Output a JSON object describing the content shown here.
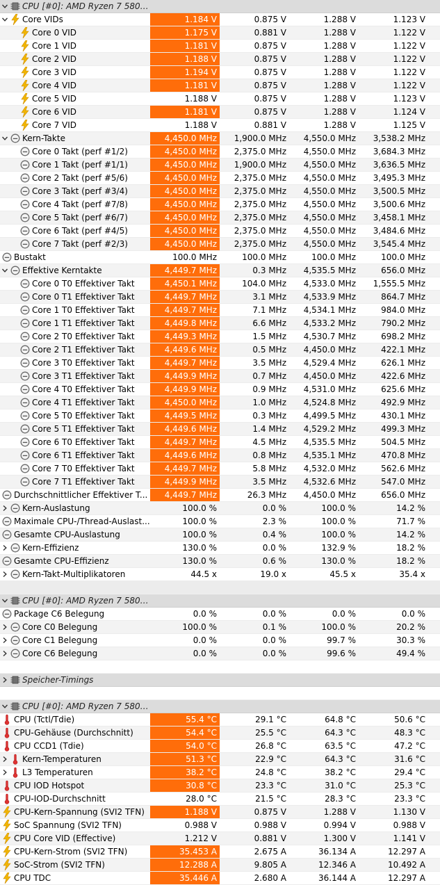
{
  "colors": {
    "highlight": "#ff6d0a",
    "header_bg": "#dcdcdc",
    "alt_row": "#f3f3f3"
  },
  "rows": [
    {
      "type": "header",
      "exp": "v",
      "icon": "chip-icon",
      "name": "CPU [#0]: AMD Ryzen 7 5800..."
    },
    {
      "exp": "v",
      "ind": 0,
      "icon": "voltage-icon",
      "name": "Core VIDs",
      "v": [
        "1.184 V",
        "0.875 V",
        "1.288 V",
        "1.123 V"
      ],
      "hl": true
    },
    {
      "ind": 1,
      "icon": "voltage-icon",
      "name": "Core 0 VID",
      "v": [
        "1.175 V",
        "0.881 V",
        "1.288 V",
        "1.122 V"
      ],
      "hl": true
    },
    {
      "ind": 1,
      "icon": "voltage-icon",
      "name": "Core 1 VID",
      "v": [
        "1.181 V",
        "0.875 V",
        "1.288 V",
        "1.122 V"
      ],
      "hl": true
    },
    {
      "ind": 1,
      "icon": "voltage-icon",
      "name": "Core 2 VID",
      "v": [
        "1.188 V",
        "0.875 V",
        "1.288 V",
        "1.122 V"
      ],
      "hl": true
    },
    {
      "ind": 1,
      "icon": "voltage-icon",
      "name": "Core 3 VID",
      "v": [
        "1.194 V",
        "0.875 V",
        "1.288 V",
        "1.122 V"
      ],
      "hl": true
    },
    {
      "ind": 1,
      "icon": "voltage-icon",
      "name": "Core 4 VID",
      "v": [
        "1.181 V",
        "0.875 V",
        "1.288 V",
        "1.122 V"
      ],
      "hl": true
    },
    {
      "ind": 1,
      "icon": "voltage-icon",
      "name": "Core 5 VID",
      "v": [
        "1.188 V",
        "0.875 V",
        "1.288 V",
        "1.123 V"
      ],
      "hl": false
    },
    {
      "ind": 1,
      "icon": "voltage-icon",
      "name": "Core 6 VID",
      "v": [
        "1.181 V",
        "0.875 V",
        "1.288 V",
        "1.124 V"
      ],
      "hl": true
    },
    {
      "ind": 1,
      "icon": "voltage-icon",
      "name": "Core 7 VID",
      "v": [
        "1.188 V",
        "0.881 V",
        "1.288 V",
        "1.125 V"
      ],
      "hl": false
    },
    {
      "exp": "v",
      "ind": 0,
      "icon": "clock-icon",
      "name": "Kern-Takte",
      "v": [
        "4,450.0 MHz",
        "1,900.0 MHz",
        "4,550.0 MHz",
        "3,538.2 MHz"
      ],
      "hl": true
    },
    {
      "ind": 1,
      "icon": "clock-icon",
      "name": "Core 0 Takt (perf #1/2)",
      "v": [
        "4,450.0 MHz",
        "2,375.0 MHz",
        "4,550.0 MHz",
        "3,684.3 MHz"
      ],
      "hl": true
    },
    {
      "ind": 1,
      "icon": "clock-icon",
      "name": "Core 1 Takt (perf #1/1)",
      "v": [
        "4,450.0 MHz",
        "1,900.0 MHz",
        "4,550.0 MHz",
        "3,636.5 MHz"
      ],
      "hl": true
    },
    {
      "ind": 1,
      "icon": "clock-icon",
      "name": "Core 2 Takt (perf #5/6)",
      "v": [
        "4,450.0 MHz",
        "2,375.0 MHz",
        "4,550.0 MHz",
        "3,495.3 MHz"
      ],
      "hl": true
    },
    {
      "ind": 1,
      "icon": "clock-icon",
      "name": "Core 3 Takt (perf #3/4)",
      "v": [
        "4,450.0 MHz",
        "2,375.0 MHz",
        "4,550.0 MHz",
        "3,500.5 MHz"
      ],
      "hl": true
    },
    {
      "ind": 1,
      "icon": "clock-icon",
      "name": "Core 4 Takt (perf #7/8)",
      "v": [
        "4,450.0 MHz",
        "2,375.0 MHz",
        "4,550.0 MHz",
        "3,500.6 MHz"
      ],
      "hl": true
    },
    {
      "ind": 1,
      "icon": "clock-icon",
      "name": "Core 5 Takt (perf #6/7)",
      "v": [
        "4,450.0 MHz",
        "2,375.0 MHz",
        "4,550.0 MHz",
        "3,458.1 MHz"
      ],
      "hl": true
    },
    {
      "ind": 1,
      "icon": "clock-icon",
      "name": "Core 6 Takt (perf #4/5)",
      "v": [
        "4,450.0 MHz",
        "2,375.0 MHz",
        "4,550.0 MHz",
        "3,484.6 MHz"
      ],
      "hl": true
    },
    {
      "ind": 1,
      "icon": "clock-icon",
      "name": "Core 7 Takt (perf #2/3)",
      "v": [
        "4,450.0 MHz",
        "2,375.0 MHz",
        "4,550.0 MHz",
        "3,545.4 MHz"
      ],
      "hl": true
    },
    {
      "ind": -1,
      "icon": "clock-icon",
      "name": "Bustakt",
      "v": [
        "100.0 MHz",
        "100.0 MHz",
        "100.0 MHz",
        "100.0 MHz"
      ],
      "hl": false
    },
    {
      "exp": "v",
      "ind": 0,
      "icon": "clock-icon",
      "name": "Effektive Kerntakte",
      "v": [
        "4,449.7 MHz",
        "0.3 MHz",
        "4,535.5 MHz",
        "656.0 MHz"
      ],
      "hl": true
    },
    {
      "ind": 1,
      "icon": "clock-icon",
      "name": "Core 0 T0 Effektiver Takt",
      "v": [
        "4,450.1 MHz",
        "104.0 MHz",
        "4,533.0 MHz",
        "1,555.5 MHz"
      ],
      "hl": true
    },
    {
      "ind": 1,
      "icon": "clock-icon",
      "name": "Core 0 T1 Effektiver Takt",
      "v": [
        "4,449.7 MHz",
        "3.1 MHz",
        "4,533.9 MHz",
        "864.7 MHz"
      ],
      "hl": true
    },
    {
      "ind": 1,
      "icon": "clock-icon",
      "name": "Core 1 T0 Effektiver Takt",
      "v": [
        "4,449.7 MHz",
        "7.1 MHz",
        "4,534.1 MHz",
        "984.0 MHz"
      ],
      "hl": true
    },
    {
      "ind": 1,
      "icon": "clock-icon",
      "name": "Core 1 T1 Effektiver Takt",
      "v": [
        "4,449.8 MHz",
        "6.6 MHz",
        "4,533.2 MHz",
        "790.2 MHz"
      ],
      "hl": true
    },
    {
      "ind": 1,
      "icon": "clock-icon",
      "name": "Core 2 T0 Effektiver Takt",
      "v": [
        "4,449.3 MHz",
        "1.5 MHz",
        "4,530.7 MHz",
        "698.2 MHz"
      ],
      "hl": true
    },
    {
      "ind": 1,
      "icon": "clock-icon",
      "name": "Core 2 T1 Effektiver Takt",
      "v": [
        "4,449.6 MHz",
        "0.5 MHz",
        "4,450.0 MHz",
        "422.1 MHz"
      ],
      "hl": true
    },
    {
      "ind": 1,
      "icon": "clock-icon",
      "name": "Core 3 T0 Effektiver Takt",
      "v": [
        "4,449.7 MHz",
        "3.5 MHz",
        "4,529.4 MHz",
        "626.1 MHz"
      ],
      "hl": true
    },
    {
      "ind": 1,
      "icon": "clock-icon",
      "name": "Core 3 T1 Effektiver Takt",
      "v": [
        "4,449.9 MHz",
        "0.7 MHz",
        "4,450.0 MHz",
        "422.6 MHz"
      ],
      "hl": true
    },
    {
      "ind": 1,
      "icon": "clock-icon",
      "name": "Core 4 T0 Effektiver Takt",
      "v": [
        "4,449.9 MHz",
        "0.9 MHz",
        "4,531.0 MHz",
        "625.6 MHz"
      ],
      "hl": true
    },
    {
      "ind": 1,
      "icon": "clock-icon",
      "name": "Core 4 T1 Effektiver Takt",
      "v": [
        "4,450.0 MHz",
        "1.0 MHz",
        "4,524.8 MHz",
        "492.9 MHz"
      ],
      "hl": true
    },
    {
      "ind": 1,
      "icon": "clock-icon",
      "name": "Core 5 T0 Effektiver Takt",
      "v": [
        "4,449.5 MHz",
        "0.3 MHz",
        "4,499.5 MHz",
        "430.1 MHz"
      ],
      "hl": true
    },
    {
      "ind": 1,
      "icon": "clock-icon",
      "name": "Core 5 T1 Effektiver Takt",
      "v": [
        "4,449.6 MHz",
        "1.4 MHz",
        "4,529.2 MHz",
        "499.3 MHz"
      ],
      "hl": true
    },
    {
      "ind": 1,
      "icon": "clock-icon",
      "name": "Core 6 T0 Effektiver Takt",
      "v": [
        "4,449.7 MHz",
        "4.5 MHz",
        "4,535.5 MHz",
        "504.5 MHz"
      ],
      "hl": true
    },
    {
      "ind": 1,
      "icon": "clock-icon",
      "name": "Core 6 T1 Effektiver Takt",
      "v": [
        "4,449.6 MHz",
        "0.8 MHz",
        "4,535.1 MHz",
        "470.8 MHz"
      ],
      "hl": true
    },
    {
      "ind": 1,
      "icon": "clock-icon",
      "name": "Core 7 T0 Effektiver Takt",
      "v": [
        "4,449.7 MHz",
        "5.8 MHz",
        "4,532.0 MHz",
        "562.6 MHz"
      ],
      "hl": true
    },
    {
      "ind": 1,
      "icon": "clock-icon",
      "name": "Core 7 T1 Effektiver Takt",
      "v": [
        "4,449.9 MHz",
        "3.5 MHz",
        "4,532.6 MHz",
        "547.0 MHz"
      ],
      "hl": true
    },
    {
      "ind": -1,
      "icon": "clock-icon",
      "name": "Durchschnittlicher Effektiver T...",
      "v": [
        "4,449.7 MHz",
        "26.3 MHz",
        "4,450.0 MHz",
        "656.0 MHz"
      ],
      "hl": true
    },
    {
      "exp": ">",
      "ind": 0,
      "icon": "clock-icon",
      "name": "Kern-Auslastung",
      "v": [
        "100.0 %",
        "0.0 %",
        "100.0 %",
        "14.2 %"
      ],
      "hl": false
    },
    {
      "ind": -1,
      "icon": "clock-icon",
      "name": "Maximale CPU-/Thread-Auslast...",
      "v": [
        "100.0 %",
        "2.3 %",
        "100.0 %",
        "71.7 %"
      ],
      "hl": false
    },
    {
      "ind": -1,
      "icon": "clock-icon",
      "name": "Gesamte CPU-Auslastung",
      "v": [
        "100.0 %",
        "0.4 %",
        "100.0 %",
        "14.2 %"
      ],
      "hl": false
    },
    {
      "exp": ">",
      "ind": 0,
      "icon": "clock-icon",
      "name": "Kern-Effizienz",
      "v": [
        "130.0 %",
        "0.0 %",
        "132.9 %",
        "18.2 %"
      ],
      "hl": false
    },
    {
      "ind": -1,
      "icon": "clock-icon",
      "name": "Gesamte CPU-Effizienz",
      "v": [
        "130.0 %",
        "0.6 %",
        "130.0 %",
        "18.2 %"
      ],
      "hl": false
    },
    {
      "exp": ">",
      "ind": 0,
      "icon": "clock-icon",
      "name": "Kern-Takt-Multiplikatoren",
      "v": [
        "44.5 x",
        "19.0 x",
        "45.5 x",
        "35.4 x"
      ],
      "hl": false
    },
    {
      "type": "blank",
      "grey": true
    },
    {
      "type": "header",
      "exp": "v",
      "icon": "chip-icon",
      "name": "CPU [#0]: AMD Ryzen 7 5800..."
    },
    {
      "ind": -1,
      "icon": "clock-icon",
      "name": "Package C6 Belegung",
      "v": [
        "0.0 %",
        "0.0 %",
        "0.0 %",
        "0.0 %"
      ],
      "hl": false
    },
    {
      "exp": ">",
      "ind": 0,
      "icon": "clock-icon",
      "name": "Core C0 Belegung",
      "v": [
        "100.0 %",
        "0.1 %",
        "100.0 %",
        "20.2 %"
      ],
      "hl": false
    },
    {
      "exp": ">",
      "ind": 0,
      "icon": "clock-icon",
      "name": "Core C1 Belegung",
      "v": [
        "0.0 %",
        "0.0 %",
        "99.7 %",
        "30.3 %"
      ],
      "hl": false
    },
    {
      "exp": ">",
      "ind": 0,
      "icon": "clock-icon",
      "name": "Core C6 Belegung",
      "v": [
        "0.0 %",
        "0.0 %",
        "99.6 %",
        "49.4 %"
      ],
      "hl": false
    },
    {
      "type": "blank"
    },
    {
      "type": "header",
      "exp": ">",
      "icon": "memory-icon",
      "name": "Speicher-Timings"
    },
    {
      "type": "blank"
    },
    {
      "type": "header",
      "exp": "v",
      "icon": "chip-icon",
      "name": "CPU [#0]: AMD Ryzen 7 5800..."
    },
    {
      "ind": -1,
      "icon": "thermometer-icon",
      "name": "CPU (Tctl/Tdie)",
      "v": [
        "55.4 °C",
        "29.1 °C",
        "64.8 °C",
        "50.6 °C"
      ],
      "hl": true
    },
    {
      "ind": -1,
      "icon": "thermometer-icon",
      "name": "CPU-Gehäuse (Durchschnitt)",
      "v": [
        "54.4 °C",
        "25.5 °C",
        "64.3 °C",
        "48.3 °C"
      ],
      "hl": true
    },
    {
      "ind": -1,
      "icon": "thermometer-icon",
      "name": "CPU CCD1 (Tdie)",
      "v": [
        "54.0 °C",
        "26.8 °C",
        "63.5 °C",
        "47.2 °C"
      ],
      "hl": true
    },
    {
      "exp": ">",
      "ind": 0,
      "icon": "thermometer-icon",
      "name": "Kern-Temperaturen",
      "v": [
        "51.3 °C",
        "22.9 °C",
        "64.3 °C",
        "31.6 °C"
      ],
      "hl": true
    },
    {
      "exp": ">",
      "ind": 0,
      "icon": "thermometer-icon",
      "name": "L3 Temperaturen",
      "v": [
        "38.2 °C",
        "24.8 °C",
        "38.2 °C",
        "29.4 °C"
      ],
      "hl": true
    },
    {
      "ind": -1,
      "icon": "thermometer-icon",
      "name": "CPU IOD Hotspot",
      "v": [
        "30.8 °C",
        "23.3 °C",
        "31.0 °C",
        "25.3 °C"
      ],
      "hl": true
    },
    {
      "ind": -1,
      "icon": "thermometer-icon",
      "name": "CPU-IOD-Durchschnitt",
      "v": [
        "28.0 °C",
        "21.5 °C",
        "28.3 °C",
        "23.3 °C"
      ],
      "hl": false
    },
    {
      "ind": -1,
      "icon": "voltage-icon",
      "name": "CPU-Kern-Spannung (SVI2 TFN)",
      "v": [
        "1.188 V",
        "0.875 V",
        "1.288 V",
        "1.130 V"
      ],
      "hl": true
    },
    {
      "ind": -1,
      "icon": "voltage-icon",
      "name": "SoC Spannung (SVI2 TFN)",
      "v": [
        "0.988 V",
        "0.988 V",
        "0.994 V",
        "0.988 V"
      ],
      "hl": false
    },
    {
      "ind": -1,
      "icon": "voltage-icon",
      "name": "CPU Core VID (Effective)",
      "v": [
        "1.212 V",
        "0.881 V",
        "1.300 V",
        "1.141 V"
      ],
      "hl": false
    },
    {
      "ind": -1,
      "icon": "voltage-icon",
      "name": "CPU-Kern-Strom (SVI2 TFN)",
      "v": [
        "35.453 A",
        "2.675 A",
        "36.134 A",
        "12.297 A"
      ],
      "hl": true
    },
    {
      "ind": -1,
      "icon": "voltage-icon",
      "name": "SoC-Strom (SVI2 TFN)",
      "v": [
        "12.288 A",
        "9.805 A",
        "12.346 A",
        "10.492 A"
      ],
      "hl": true
    },
    {
      "ind": -1,
      "icon": "voltage-icon",
      "name": "CPU TDC",
      "v": [
        "35.446 A",
        "2.680 A",
        "36.144 A",
        "12.297 A"
      ],
      "hl": true
    }
  ]
}
